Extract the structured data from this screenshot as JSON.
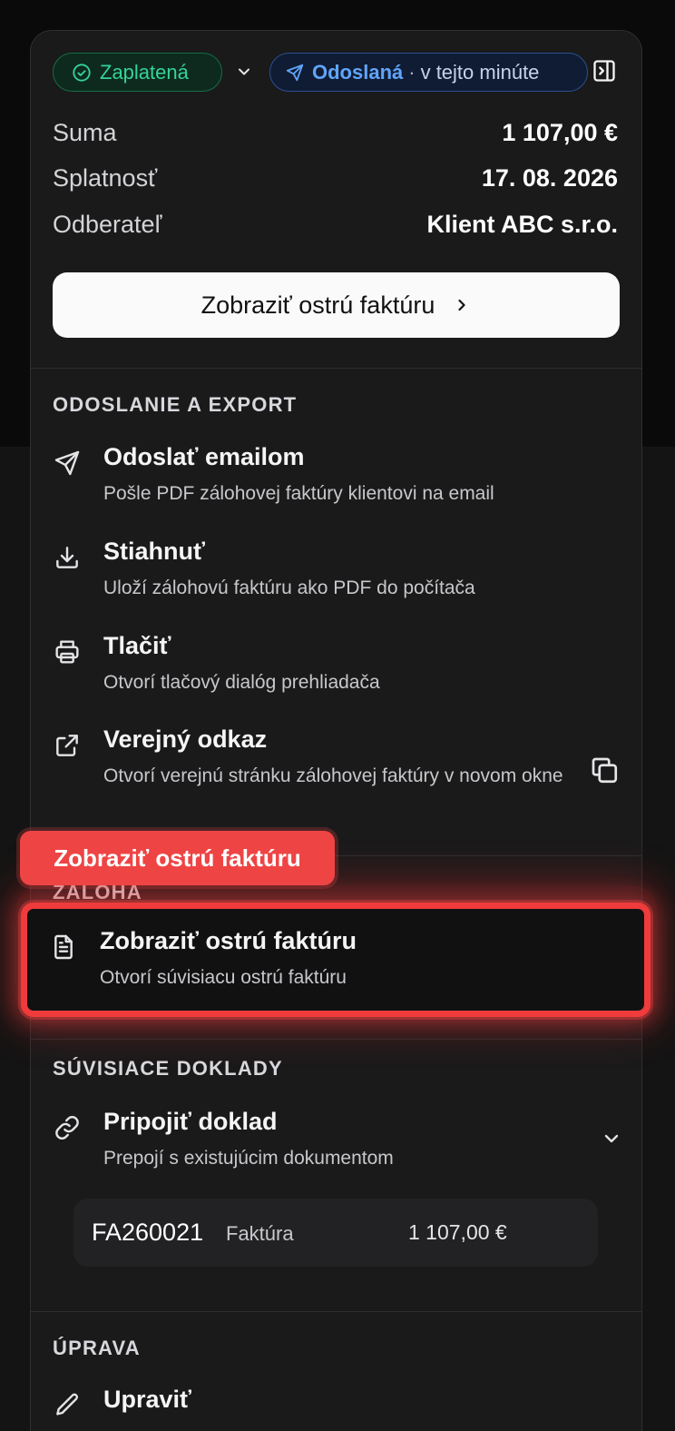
{
  "status": {
    "paid_label": "Zaplatená",
    "sent_label": "Odoslaná",
    "sent_separator": "·",
    "sent_time": "v tejto minúte"
  },
  "summary": {
    "rows": [
      {
        "label": "Suma",
        "value": "1 107,00 €"
      },
      {
        "label": "Splatnosť",
        "value": "17. 08. 2026"
      },
      {
        "label": "Odberateľ",
        "value": "Klient ABC s.r.o."
      }
    ],
    "primary_button": "Zobraziť ostrú faktúru"
  },
  "sections": {
    "export": {
      "title": "ODOSLANIE A EXPORT",
      "items": [
        {
          "title": "Odoslať emailom",
          "desc": "Pošle PDF zálohovej faktúry klientovi na email",
          "icon": "send-icon"
        },
        {
          "title": "Stiahnuť",
          "desc": "Uloží zálohovú faktúru ako PDF do počítača",
          "icon": "download-icon"
        },
        {
          "title": "Tlačiť",
          "desc": "Otvorí tlačový dialóg prehliadača",
          "icon": "printer-icon"
        },
        {
          "title": "Verejný odkaz",
          "desc": "Otvorí verejnú stránku zálohovej faktúry v novom okne",
          "icon": "external-link-icon"
        }
      ]
    },
    "zaloha": {
      "title": "ZÁLOHA",
      "items": [
        {
          "title": "Zobraziť ostrú faktúru",
          "desc": "Otvorí súvisiacu ostrú faktúru",
          "icon": "document-icon"
        }
      ]
    },
    "related": {
      "title": "SÚVISIACE DOKLADY",
      "items": [
        {
          "title": "Pripojiť doklad",
          "desc": "Prepojí s existujúcim dokumentom",
          "icon": "link-icon"
        }
      ],
      "documents": [
        {
          "number": "FA260021",
          "type": "Faktúra",
          "amount": "1 107,00 €"
        }
      ]
    },
    "edit": {
      "title": "ÚPRAVA",
      "items": [
        {
          "title": "Upraviť",
          "icon": "pencil-icon"
        }
      ]
    }
  },
  "tooltip": "Zobraziť ostrú faktúru",
  "colors": {
    "paid": "#34d399",
    "sent": "#60a5fa",
    "highlight": "#ef4444"
  }
}
